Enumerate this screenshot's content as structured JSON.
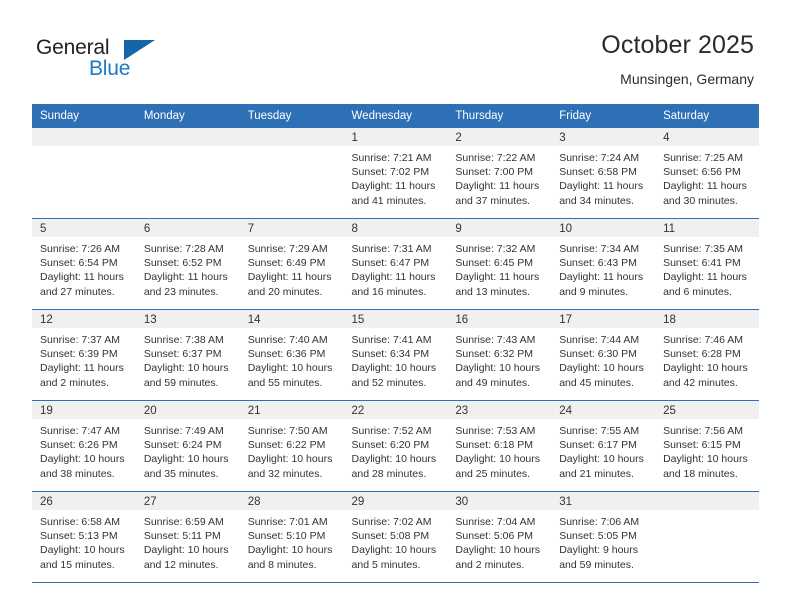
{
  "brand": {
    "name_part1": "General",
    "name_part2": "Blue",
    "triangle_icon": "triangle-icon",
    "color_dark": "#231f20",
    "color_blue": "#1a7bc9",
    "color_triangle": "#1565a8"
  },
  "header": {
    "title": "October 2025",
    "subtitle": "Munsingen, Germany"
  },
  "colors": {
    "header_blue": "#2e70b5",
    "band_gray": "#f0f0f0",
    "text": "#333333"
  },
  "weekday_headers": [
    "Sunday",
    "Monday",
    "Tuesday",
    "Wednesday",
    "Thursday",
    "Friday",
    "Saturday"
  ],
  "weeks": [
    [
      {
        "day": "",
        "sunrise": "",
        "sunset": "",
        "daylight_line1": "",
        "daylight_line2": "",
        "empty": true
      },
      {
        "day": "",
        "sunrise": "",
        "sunset": "",
        "daylight_line1": "",
        "daylight_line2": "",
        "empty": true
      },
      {
        "day": "",
        "sunrise": "",
        "sunset": "",
        "daylight_line1": "",
        "daylight_line2": "",
        "empty": true
      },
      {
        "day": "1",
        "sunrise": "Sunrise: 7:21 AM",
        "sunset": "Sunset: 7:02 PM",
        "daylight_line1": "Daylight: 11 hours",
        "daylight_line2": "and 41 minutes.",
        "empty": false
      },
      {
        "day": "2",
        "sunrise": "Sunrise: 7:22 AM",
        "sunset": "Sunset: 7:00 PM",
        "daylight_line1": "Daylight: 11 hours",
        "daylight_line2": "and 37 minutes.",
        "empty": false
      },
      {
        "day": "3",
        "sunrise": "Sunrise: 7:24 AM",
        "sunset": "Sunset: 6:58 PM",
        "daylight_line1": "Daylight: 11 hours",
        "daylight_line2": "and 34 minutes.",
        "empty": false
      },
      {
        "day": "4",
        "sunrise": "Sunrise: 7:25 AM",
        "sunset": "Sunset: 6:56 PM",
        "daylight_line1": "Daylight: 11 hours",
        "daylight_line2": "and 30 minutes.",
        "empty": false
      }
    ],
    [
      {
        "day": "5",
        "sunrise": "Sunrise: 7:26 AM",
        "sunset": "Sunset: 6:54 PM",
        "daylight_line1": "Daylight: 11 hours",
        "daylight_line2": "and 27 minutes.",
        "empty": false
      },
      {
        "day": "6",
        "sunrise": "Sunrise: 7:28 AM",
        "sunset": "Sunset: 6:52 PM",
        "daylight_line1": "Daylight: 11 hours",
        "daylight_line2": "and 23 minutes.",
        "empty": false
      },
      {
        "day": "7",
        "sunrise": "Sunrise: 7:29 AM",
        "sunset": "Sunset: 6:49 PM",
        "daylight_line1": "Daylight: 11 hours",
        "daylight_line2": "and 20 minutes.",
        "empty": false
      },
      {
        "day": "8",
        "sunrise": "Sunrise: 7:31 AM",
        "sunset": "Sunset: 6:47 PM",
        "daylight_line1": "Daylight: 11 hours",
        "daylight_line2": "and 16 minutes.",
        "empty": false
      },
      {
        "day": "9",
        "sunrise": "Sunrise: 7:32 AM",
        "sunset": "Sunset: 6:45 PM",
        "daylight_line1": "Daylight: 11 hours",
        "daylight_line2": "and 13 minutes.",
        "empty": false
      },
      {
        "day": "10",
        "sunrise": "Sunrise: 7:34 AM",
        "sunset": "Sunset: 6:43 PM",
        "daylight_line1": "Daylight: 11 hours",
        "daylight_line2": "and 9 minutes.",
        "empty": false
      },
      {
        "day": "11",
        "sunrise": "Sunrise: 7:35 AM",
        "sunset": "Sunset: 6:41 PM",
        "daylight_line1": "Daylight: 11 hours",
        "daylight_line2": "and 6 minutes.",
        "empty": false
      }
    ],
    [
      {
        "day": "12",
        "sunrise": "Sunrise: 7:37 AM",
        "sunset": "Sunset: 6:39 PM",
        "daylight_line1": "Daylight: 11 hours",
        "daylight_line2": "and 2 minutes.",
        "empty": false
      },
      {
        "day": "13",
        "sunrise": "Sunrise: 7:38 AM",
        "sunset": "Sunset: 6:37 PM",
        "daylight_line1": "Daylight: 10 hours",
        "daylight_line2": "and 59 minutes.",
        "empty": false
      },
      {
        "day": "14",
        "sunrise": "Sunrise: 7:40 AM",
        "sunset": "Sunset: 6:36 PM",
        "daylight_line1": "Daylight: 10 hours",
        "daylight_line2": "and 55 minutes.",
        "empty": false
      },
      {
        "day": "15",
        "sunrise": "Sunrise: 7:41 AM",
        "sunset": "Sunset: 6:34 PM",
        "daylight_line1": "Daylight: 10 hours",
        "daylight_line2": "and 52 minutes.",
        "empty": false
      },
      {
        "day": "16",
        "sunrise": "Sunrise: 7:43 AM",
        "sunset": "Sunset: 6:32 PM",
        "daylight_line1": "Daylight: 10 hours",
        "daylight_line2": "and 49 minutes.",
        "empty": false
      },
      {
        "day": "17",
        "sunrise": "Sunrise: 7:44 AM",
        "sunset": "Sunset: 6:30 PM",
        "daylight_line1": "Daylight: 10 hours",
        "daylight_line2": "and 45 minutes.",
        "empty": false
      },
      {
        "day": "18",
        "sunrise": "Sunrise: 7:46 AM",
        "sunset": "Sunset: 6:28 PM",
        "daylight_line1": "Daylight: 10 hours",
        "daylight_line2": "and 42 minutes.",
        "empty": false
      }
    ],
    [
      {
        "day": "19",
        "sunrise": "Sunrise: 7:47 AM",
        "sunset": "Sunset: 6:26 PM",
        "daylight_line1": "Daylight: 10 hours",
        "daylight_line2": "and 38 minutes.",
        "empty": false
      },
      {
        "day": "20",
        "sunrise": "Sunrise: 7:49 AM",
        "sunset": "Sunset: 6:24 PM",
        "daylight_line1": "Daylight: 10 hours",
        "daylight_line2": "and 35 minutes.",
        "empty": false
      },
      {
        "day": "21",
        "sunrise": "Sunrise: 7:50 AM",
        "sunset": "Sunset: 6:22 PM",
        "daylight_line1": "Daylight: 10 hours",
        "daylight_line2": "and 32 minutes.",
        "empty": false
      },
      {
        "day": "22",
        "sunrise": "Sunrise: 7:52 AM",
        "sunset": "Sunset: 6:20 PM",
        "daylight_line1": "Daylight: 10 hours",
        "daylight_line2": "and 28 minutes.",
        "empty": false
      },
      {
        "day": "23",
        "sunrise": "Sunrise: 7:53 AM",
        "sunset": "Sunset: 6:18 PM",
        "daylight_line1": "Daylight: 10 hours",
        "daylight_line2": "and 25 minutes.",
        "empty": false
      },
      {
        "day": "24",
        "sunrise": "Sunrise: 7:55 AM",
        "sunset": "Sunset: 6:17 PM",
        "daylight_line1": "Daylight: 10 hours",
        "daylight_line2": "and 21 minutes.",
        "empty": false
      },
      {
        "day": "25",
        "sunrise": "Sunrise: 7:56 AM",
        "sunset": "Sunset: 6:15 PM",
        "daylight_line1": "Daylight: 10 hours",
        "daylight_line2": "and 18 minutes.",
        "empty": false
      }
    ],
    [
      {
        "day": "26",
        "sunrise": "Sunrise: 6:58 AM",
        "sunset": "Sunset: 5:13 PM",
        "daylight_line1": "Daylight: 10 hours",
        "daylight_line2": "and 15 minutes.",
        "empty": false
      },
      {
        "day": "27",
        "sunrise": "Sunrise: 6:59 AM",
        "sunset": "Sunset: 5:11 PM",
        "daylight_line1": "Daylight: 10 hours",
        "daylight_line2": "and 12 minutes.",
        "empty": false
      },
      {
        "day": "28",
        "sunrise": "Sunrise: 7:01 AM",
        "sunset": "Sunset: 5:10 PM",
        "daylight_line1": "Daylight: 10 hours",
        "daylight_line2": "and 8 minutes.",
        "empty": false
      },
      {
        "day": "29",
        "sunrise": "Sunrise: 7:02 AM",
        "sunset": "Sunset: 5:08 PM",
        "daylight_line1": "Daylight: 10 hours",
        "daylight_line2": "and 5 minutes.",
        "empty": false
      },
      {
        "day": "30",
        "sunrise": "Sunrise: 7:04 AM",
        "sunset": "Sunset: 5:06 PM",
        "daylight_line1": "Daylight: 10 hours",
        "daylight_line2": "and 2 minutes.",
        "empty": false
      },
      {
        "day": "31",
        "sunrise": "Sunrise: 7:06 AM",
        "sunset": "Sunset: 5:05 PM",
        "daylight_line1": "Daylight: 9 hours",
        "daylight_line2": "and 59 minutes.",
        "empty": false
      },
      {
        "day": "",
        "sunrise": "",
        "sunset": "",
        "daylight_line1": "",
        "daylight_line2": "",
        "empty": true
      }
    ]
  ]
}
